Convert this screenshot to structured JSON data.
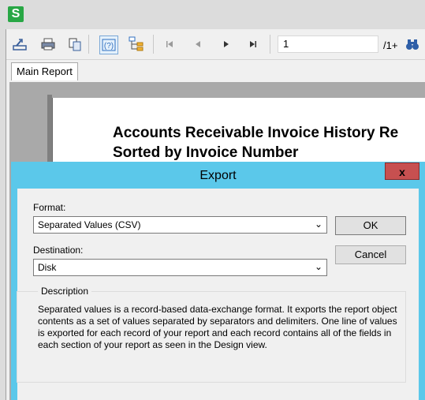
{
  "app": {
    "icon_letter": "S"
  },
  "toolbar": {
    "page_value": "1",
    "page_total": "/1+"
  },
  "tabs": [
    {
      "label": "Main Report"
    }
  ],
  "report": {
    "title": "Accounts Receivable Invoice History Re",
    "subtitle": "Sorted by Invoice Number"
  },
  "dialog": {
    "title": "Export",
    "close_label": "x",
    "format_label": "Format:",
    "format_value": "Separated Values (CSV)",
    "destination_label": "Destination:",
    "destination_value": "Disk",
    "ok_label": "OK",
    "cancel_label": "Cancel",
    "description_legend": "Description",
    "description_text": "Separated values is a record-based data-exchange format.  It exports the report object contents as a set of values separated by separators and delimiters.  One line of values is exported for each record of your report and each record contains all of the fields in each section of your report as seen in the Design view."
  },
  "colors": {
    "dialog_frame": "#5bc8ea",
    "close_button": "#c75050",
    "app_icon": "#28a745"
  }
}
